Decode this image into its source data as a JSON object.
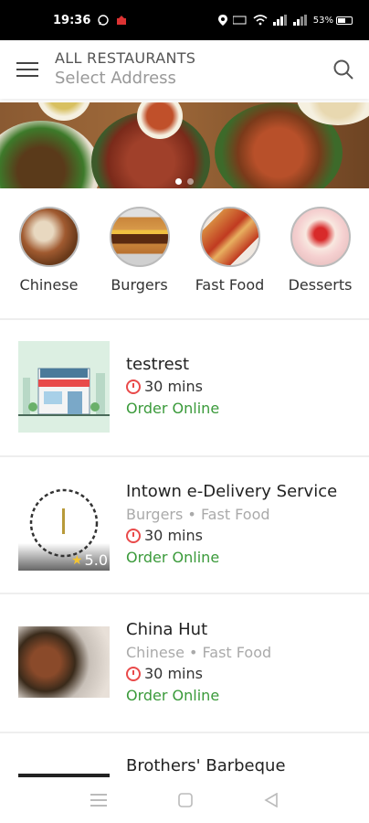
{
  "status_bar": {
    "time": "19:36",
    "battery": "53%"
  },
  "header": {
    "title": "ALL RESTAURANTS",
    "address_placeholder": "Select Address"
  },
  "categories": [
    {
      "label": "Chinese"
    },
    {
      "label": "Burgers"
    },
    {
      "label": "Fast Food"
    },
    {
      "label": "Desserts"
    }
  ],
  "restaurants": [
    {
      "name": "testrest",
      "cuisine": "",
      "time": "30 mins",
      "order": "Order Online",
      "rating": ""
    },
    {
      "name": "Intown e-Delivery Service",
      "cuisine": "Burgers • Fast Food",
      "time": "30 mins",
      "order": "Order Online",
      "rating": "5.0"
    },
    {
      "name": "China Hut",
      "cuisine": "Chinese • Fast Food",
      "time": "30 mins",
      "order": "Order Online",
      "rating": ""
    },
    {
      "name": "Brothers' Barbeque",
      "cuisine": "",
      "time": "",
      "order": "",
      "rating": ""
    }
  ],
  "colors": {
    "accent_green": "#3a9a3a",
    "clock_red": "#e94a4a",
    "rating_star": "#f4c430"
  }
}
